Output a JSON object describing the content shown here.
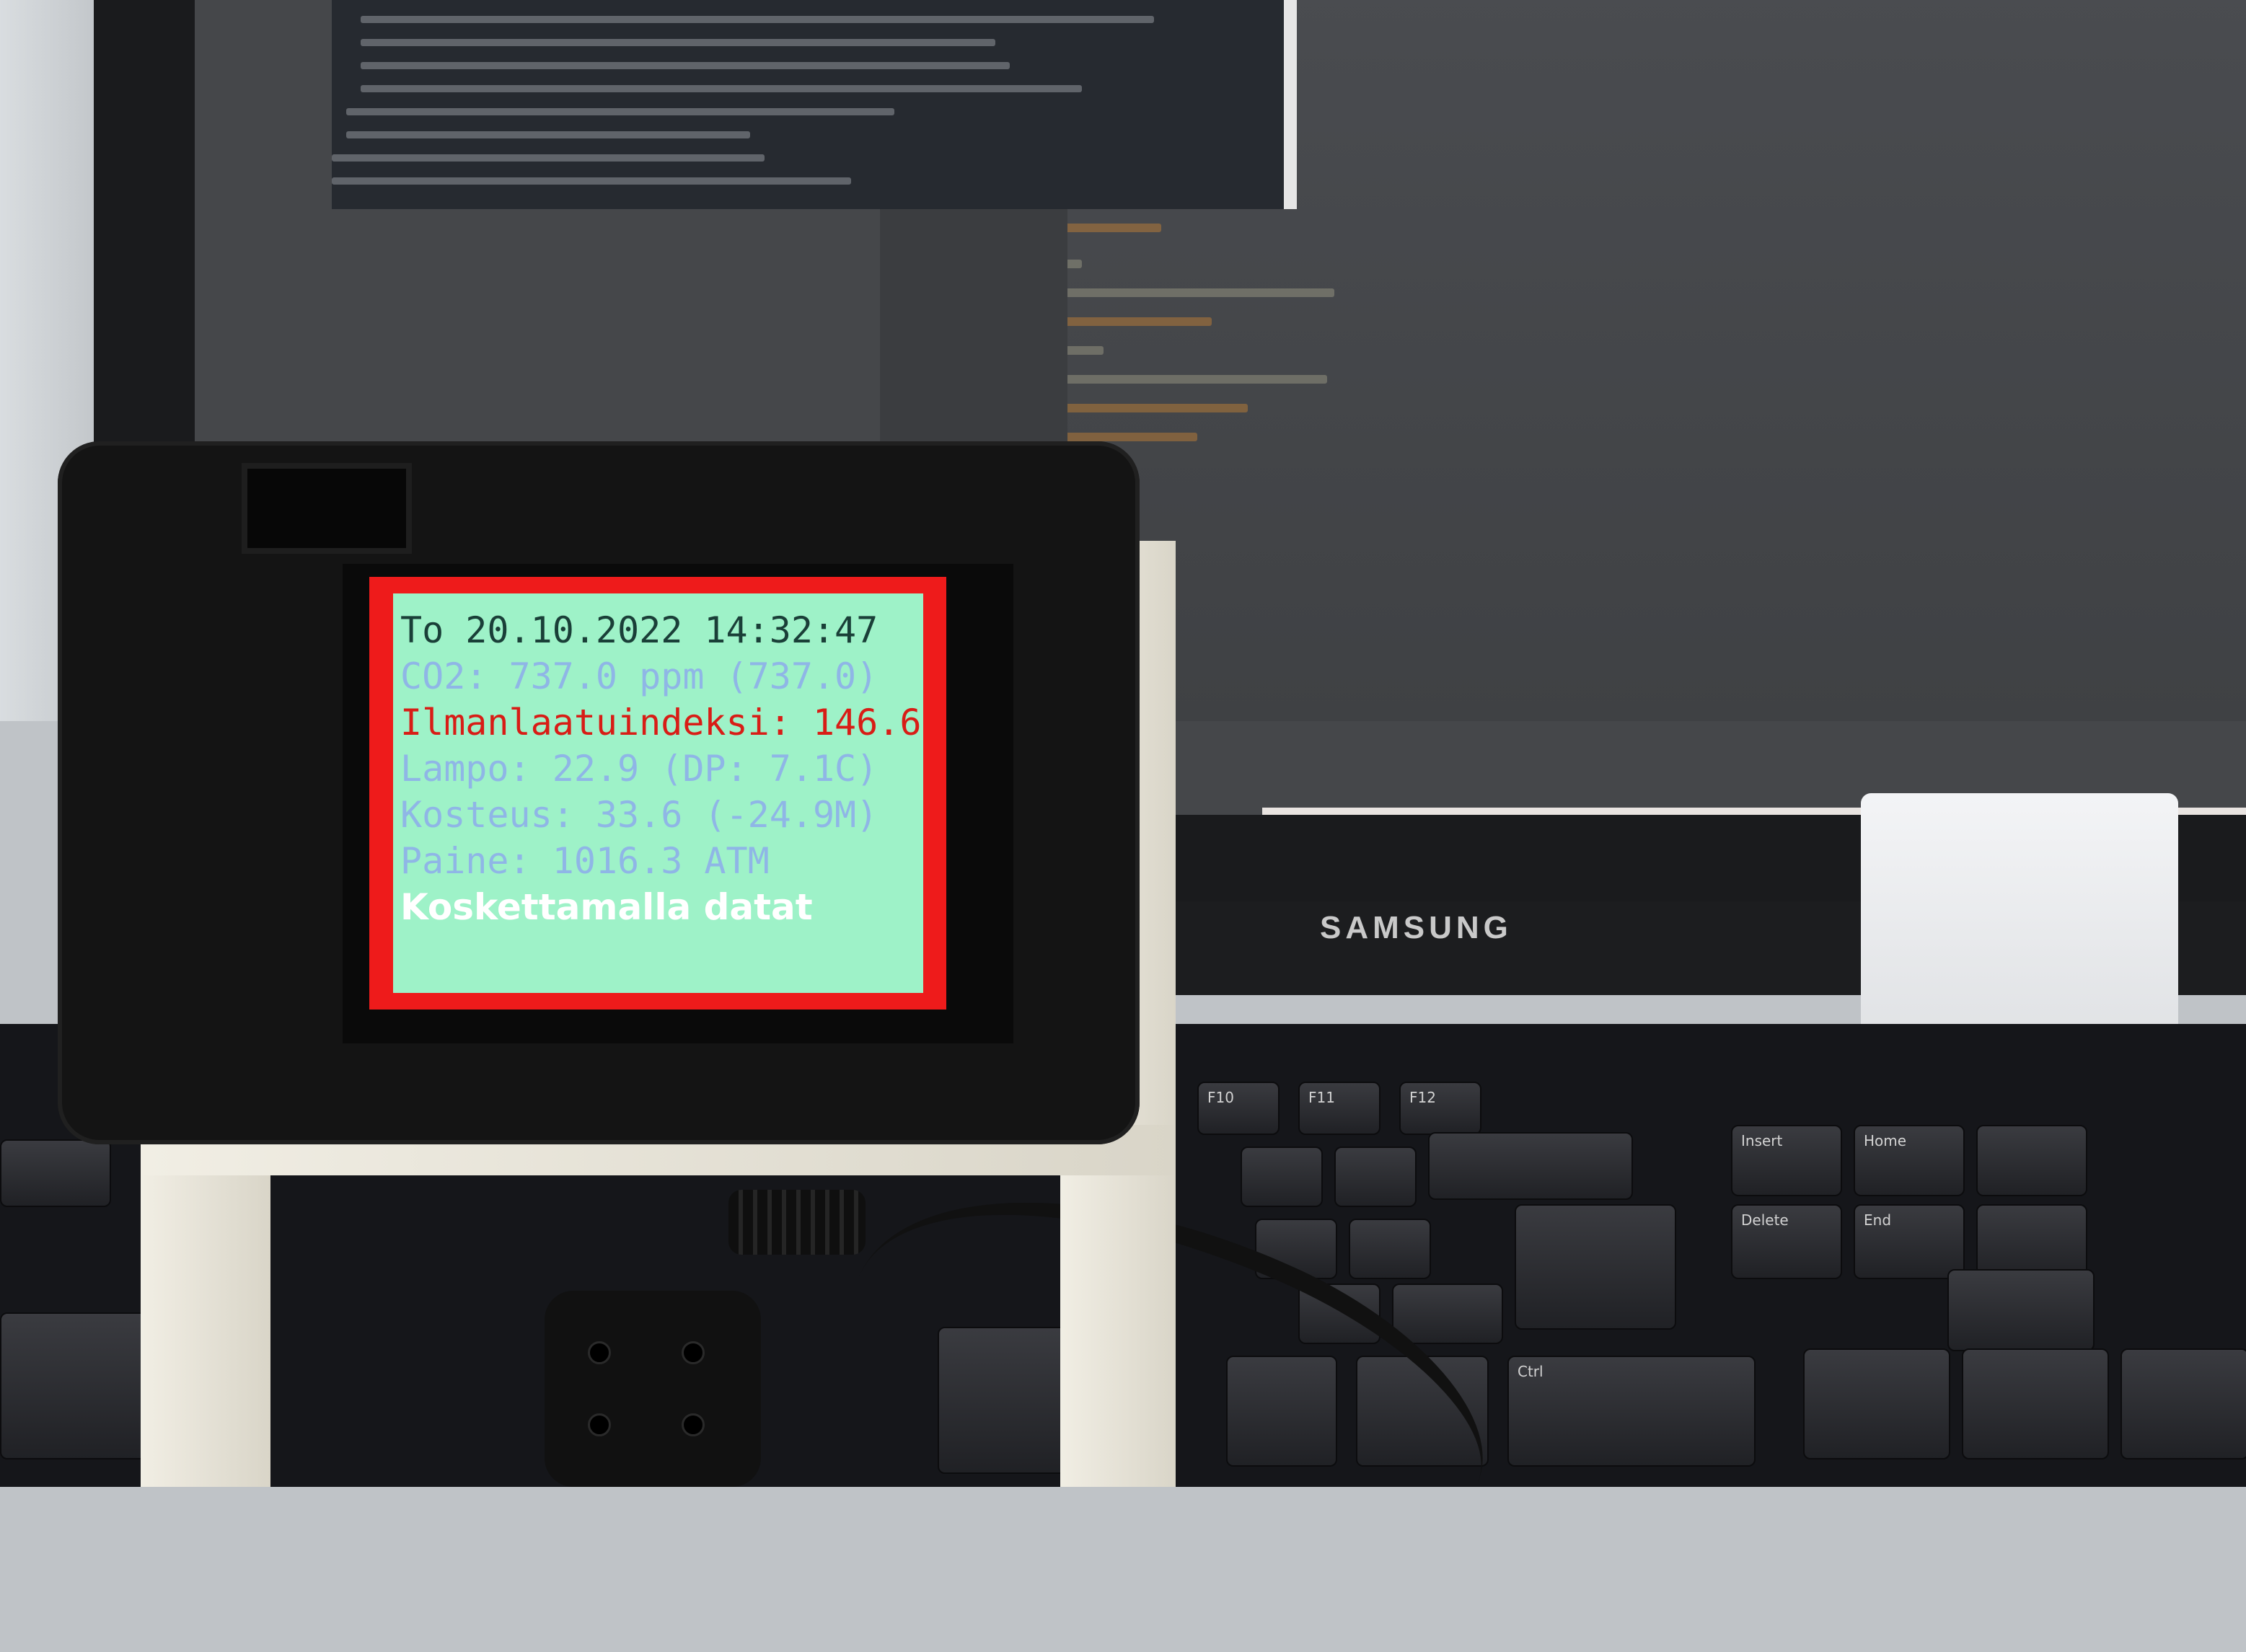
{
  "monitor": {
    "brand": "SAMSUNG",
    "taskbar_icons": [
      "photos-icon",
      "python-icon",
      "browser-icon",
      "teams-icon",
      "vlc-icon",
      "folder-icon"
    ]
  },
  "keyboard": {
    "visible_key_labels": [
      "F10",
      "F11",
      "F12",
      "Insert",
      "Home",
      "Delete",
      "End",
      "Ctrl"
    ]
  },
  "device_display": {
    "date_line": "To 20.10.2022 14:32:47",
    "co2_line": "CO2: 737.0 ppm (737.0)",
    "aqi_line": "Ilmanlaatuindeksi: 146.6",
    "temp_line": "Lampo: 22.9 (DP: 7.1C)",
    "humidity_line": "Kosteus: 33.6 (-24.9M)",
    "pressure_line": "Paine: 1016.3 ATM",
    "touch_hint": "Koskettamalla datat",
    "colors": {
      "background": "#9ef2c8",
      "border": "#ee1b1b",
      "date_text": "#1a3f38",
      "value_text": "#8fb6e6",
      "alert_text": "#d81d16",
      "hint_text": "#ffffff"
    }
  }
}
